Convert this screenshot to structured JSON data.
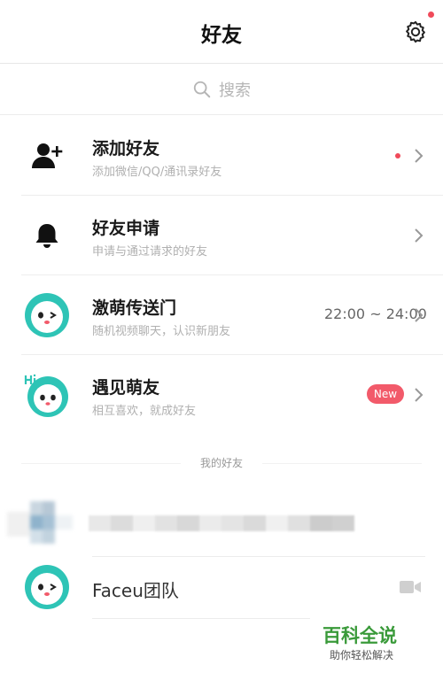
{
  "header": {
    "title": "好友"
  },
  "search": {
    "placeholder": "搜索"
  },
  "menu": [
    {
      "title": "添加好友",
      "subtitle": "添加微信/QQ/通讯录好友",
      "icon": "add-user-icon"
    },
    {
      "title": "好友申请",
      "subtitle": "申请与通过请求的好友",
      "icon": "bell-icon"
    },
    {
      "title": "激萌传送门",
      "subtitle": "随机视频聊天，认识新朋友",
      "extra": "22:00 ~ 24:00",
      "icon": "faceu-mascot-icon"
    },
    {
      "title": "遇见萌友",
      "subtitle": "相互喜欢，就成好友",
      "badge": "New",
      "icon": "faceu-hi-mascot-icon"
    }
  ],
  "friends_section": {
    "label": "我的好友"
  },
  "friends": [
    {
      "name": "Faceu团队",
      "icon": "faceu-mascot-icon"
    }
  ],
  "watermark": {
    "main": "百科全说",
    "sub": "助你轻松解决"
  },
  "colors": {
    "accent_red": "#f04a5a",
    "mascot_teal": "#2ec4b6",
    "watermark_green": "#3a9a3a"
  }
}
